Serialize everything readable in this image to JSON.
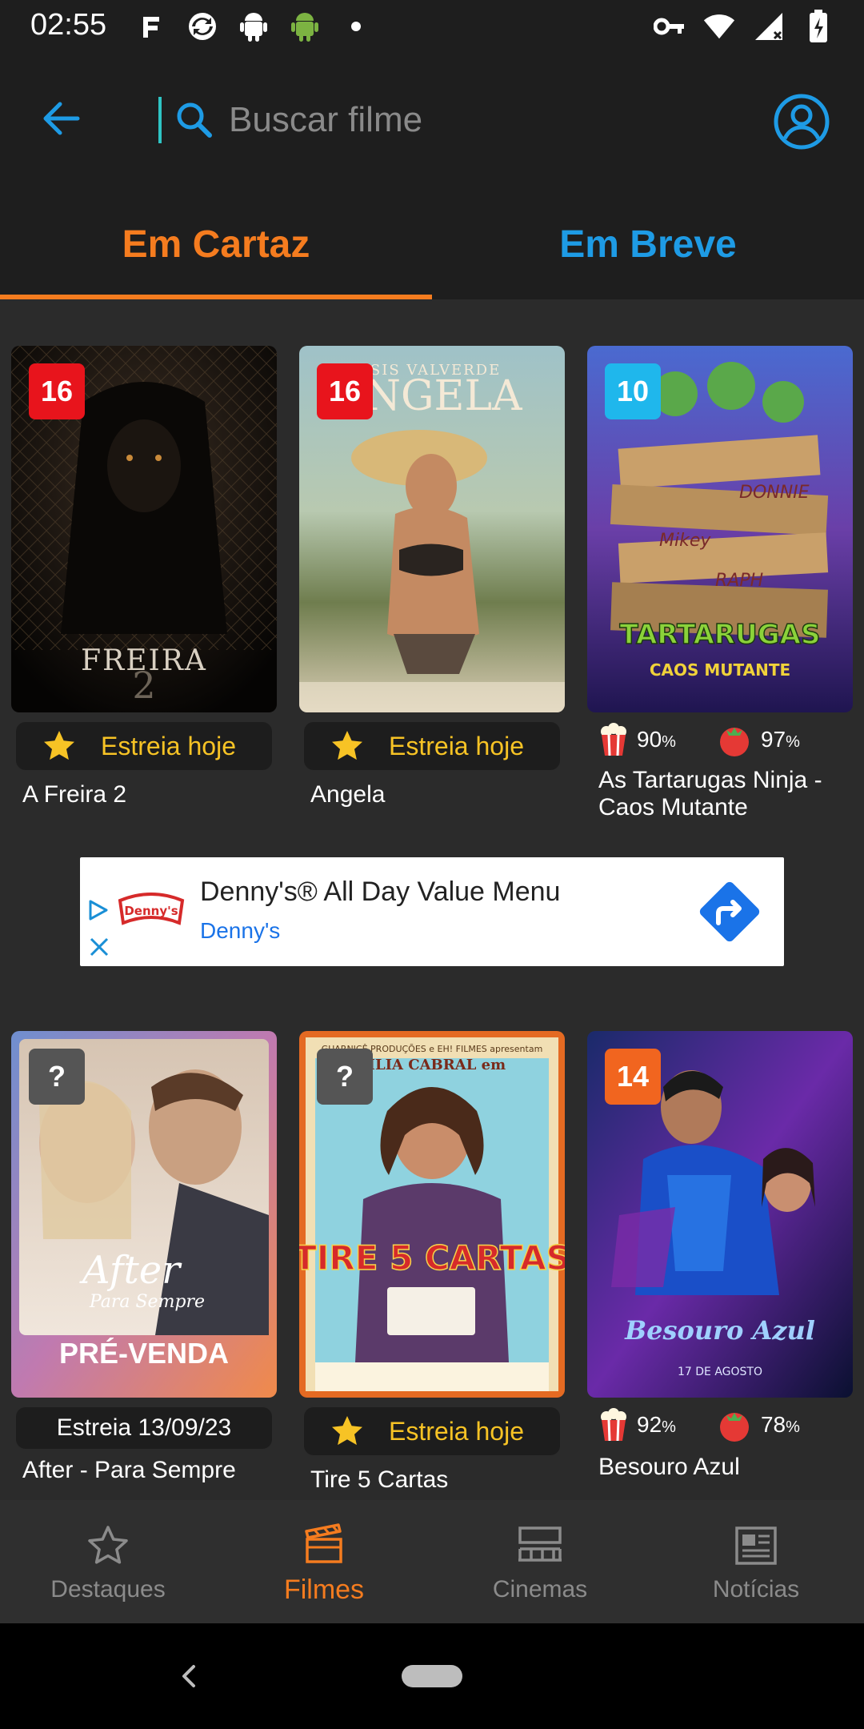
{
  "status": {
    "time": "02:55"
  },
  "search": {
    "placeholder": "Buscar filme"
  },
  "tabs": [
    {
      "label": "Em Cartaz",
      "active": true
    },
    {
      "label": "Em Breve",
      "active": false
    }
  ],
  "movies": [
    {
      "title": "A Freira 2",
      "rating": "16",
      "rating_color": "#e8141c",
      "badge": "Estreia hoje"
    },
    {
      "title": "Angela",
      "rating": "16",
      "rating_color": "#e8141c",
      "badge": "Estreia hoje"
    },
    {
      "title": "As Tartarugas Ninja - Caos Mutante",
      "rating": "10",
      "rating_color": "#1fb7ec",
      "popcorn": "90",
      "tomato": "97",
      "pct": "%"
    },
    {
      "title": "After - Para Sempre",
      "rating": "?",
      "rating_color": "#555555",
      "presale": "PRÉ-VENDA",
      "date_badge": "Estreia 13/09/23"
    },
    {
      "title": "Tire 5 Cartas",
      "rating": "?",
      "rating_color": "#555555",
      "badge": "Estreia hoje"
    },
    {
      "title": "Besouro Azul",
      "rating": "14",
      "rating_color": "#f1651f",
      "popcorn": "92",
      "tomato": "78",
      "pct": "%"
    }
  ],
  "ad": {
    "title": "Denny's® All Day Value Menu",
    "advertiser": "Denny's",
    "logo_text": "Denny's"
  },
  "nav": [
    {
      "label": "Destaques",
      "icon": "star-outline-icon",
      "active": false
    },
    {
      "label": "Filmes",
      "icon": "clapperboard-icon",
      "active": true
    },
    {
      "label": "Cinemas",
      "icon": "cinema-seats-icon",
      "active": false
    },
    {
      "label": "Notícias",
      "icon": "newspaper-icon",
      "active": false
    }
  ],
  "colors": {
    "accent": "#f57c1f",
    "secondary": "#1e9be5",
    "star": "#f7c325"
  }
}
